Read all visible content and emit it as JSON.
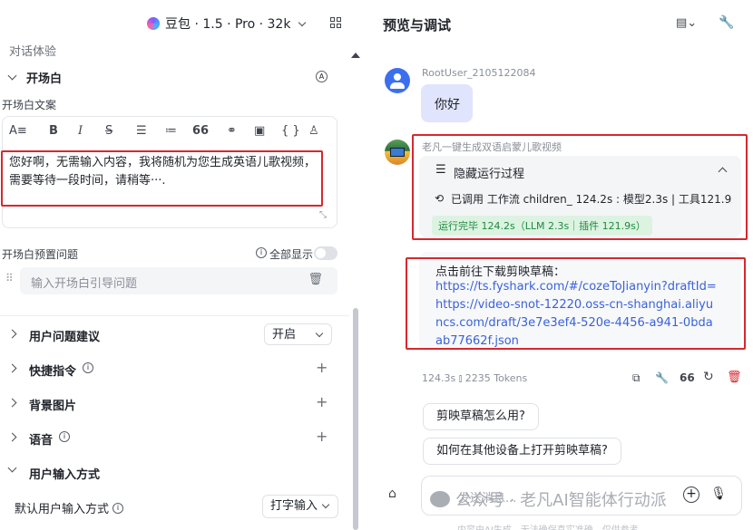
{
  "top": {
    "model_label": "豆包 · 1.5 · Pro · 32k"
  },
  "left": {
    "section_dialog": "对话体验",
    "section_opening": "开场白",
    "opening_text_label": "开场白文案",
    "opening_text": "您好啊，无需输入内容，我将随机为您生成英语儿歌视频，需要等待一段时间，请稍等···.",
    "preset_label": "开场白预置问题",
    "show_all_label": "全部显示",
    "preset_placeholder": "输入开场白引导问题",
    "rows": [
      {
        "label": "用户问题建议",
        "value": "开启"
      },
      {
        "label": "快捷指令"
      },
      {
        "label": "背景图片"
      },
      {
        "label": "语音"
      },
      {
        "label": "用户输入方式"
      }
    ],
    "default_input_label": "默认用户输入方式",
    "default_input_value": "打字输入"
  },
  "right": {
    "title": "预览与调试",
    "user_name": "RootUser_2105122084",
    "user_msg": "你好",
    "bot_name": "老凡一键生成双语启蒙儿歌视频",
    "process_title": "隐藏运行过程",
    "process_detail": "已调用 工作流 children_ 124.2s : 模型2.3s | 工具121.9s",
    "process_done": "运行完毕 124.2s（LLM 2.3s｜插件 121.9s）",
    "result_title": "点击前往下载剪映草稿：",
    "result_link": "https://ts.fyshark.com/#/cozeToJianyin?draftId=https://video-snot-12220.oss-cn-shanghai.aliyuncs.com/draft/3e7e3ef4-520e-4456-a941-0bdaab77662f.json",
    "stats": "124.3s ⫾ 2235 Tokens",
    "suggest_1": "剪映草稿怎么用?",
    "suggest_2": "如何在其他设备上打开剪映草稿?",
    "input_placeholder": "发送消息...",
    "watermark": "公众号 · 老凡AI智能体行动派",
    "footer": "内容由AI生成，无法确保真实准确，仅供参考"
  }
}
